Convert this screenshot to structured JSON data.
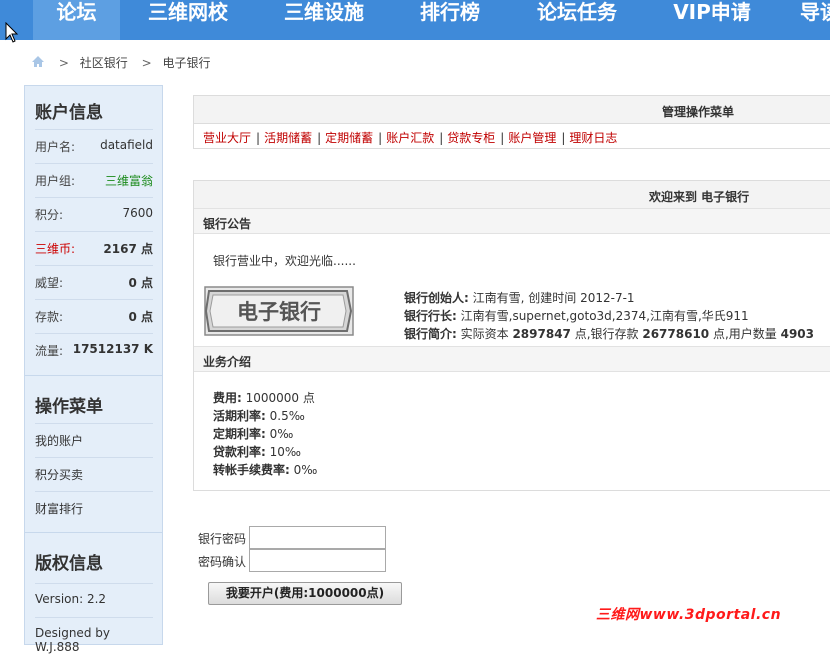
{
  "nav": {
    "items": [
      "论坛",
      "三维网校",
      "三维设施",
      "排行榜",
      "论坛任务",
      "VIP申请",
      "导读"
    ],
    "active_index": 0
  },
  "breadcrumb": {
    "home_icon": "home-icon",
    "items": [
      "社区银行",
      "电子银行"
    ],
    "separator": ">"
  },
  "account": {
    "title": "账户信息",
    "rows": [
      {
        "label": "用户名:",
        "value": "datafield"
      },
      {
        "label": "用户组:",
        "value": "三维富翁"
      },
      {
        "label": "积分:",
        "value": "7600"
      },
      {
        "label": "三维币:",
        "value": "2167 点"
      },
      {
        "label": "威望:",
        "value": "0 点"
      },
      {
        "label": "存款:",
        "value": "0 点"
      },
      {
        "label": "流量:",
        "value": "17512137 K"
      }
    ]
  },
  "ops_menu": {
    "title": "操作菜单",
    "items": [
      "我的账户",
      "积分买卖",
      "财富排行"
    ]
  },
  "copyright": {
    "title": "版权信息",
    "version": "Version: 2.2",
    "cut_line": "Designed by W.J.888"
  },
  "manage": {
    "title": "管理操作菜单",
    "links": [
      "营业大厅",
      "活期储蓄",
      "定期储蓄",
      "账户汇款",
      "贷款专柜",
      "账户管理",
      "理财日志"
    ]
  },
  "welcome": {
    "title": "欢迎来到 电子银行",
    "notice_head": "银行公告",
    "notice_text": "银行营业中，欢迎光临......",
    "logo_text": "电子银行",
    "founder_label": "银行创始人:",
    "founder_value": " 江南有雪, 创建时间 2012-7-1",
    "governor_label": "银行行长:",
    "governor_value": " 江南有雪,supernet,goto3d,2374,江南有雪,华氏911",
    "intro_label": "银行简介:",
    "intro_prefix": " 实际资本 ",
    "capital": "2897847",
    "intro_mid": " 点,银行存款 ",
    "deposits": "26778610",
    "intro_mid2": " 点,用户数量 ",
    "users": "4903",
    "biz_head": "业务介绍",
    "biz": [
      {
        "label": "费用:",
        "value": " 1000000 点"
      },
      {
        "label": "活期利率:",
        "value": " 0.5‰"
      },
      {
        "label": "定期利率:",
        "value": " 0‰"
      },
      {
        "label": "贷款利率:",
        "value": " 10‰"
      },
      {
        "label": "转帐手续费率:",
        "value": " 0‰"
      }
    ]
  },
  "form": {
    "password_label": "银行密码",
    "confirm_label": "密码确认",
    "submit_label": "我要开户(费用:1000000点)"
  },
  "watermark": "三维网www.3dportal.cn",
  "colors": {
    "nav_bg": "#3f8ad9",
    "link_red": "#c00000",
    "group_green": "#1a8a1a",
    "coin_red": "#cc0000"
  }
}
